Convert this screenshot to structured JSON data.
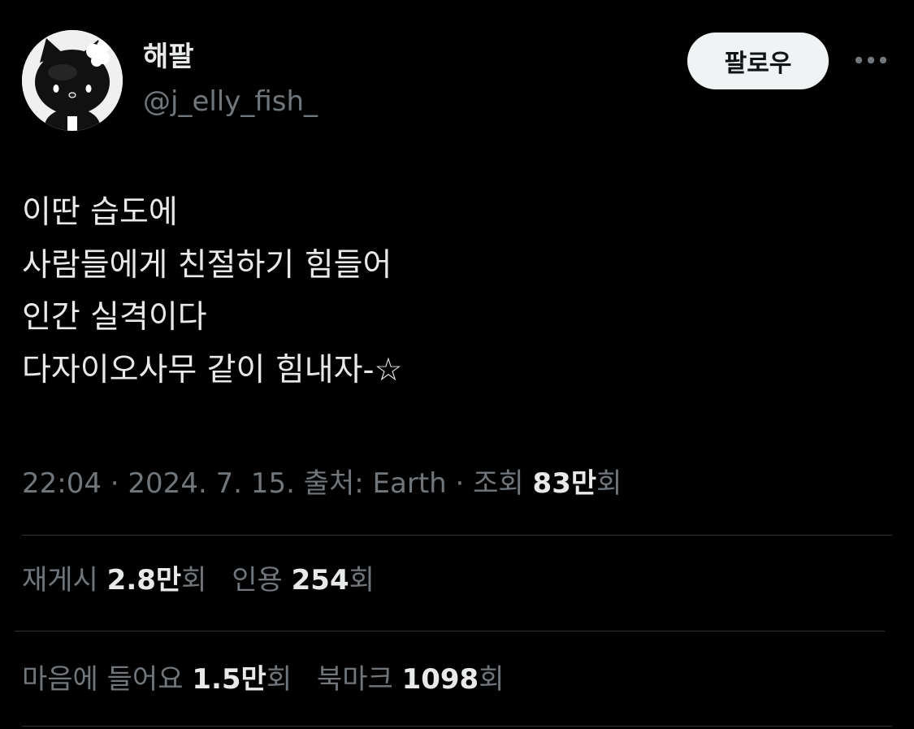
{
  "user": {
    "display_name": "해팔",
    "handle": "@j_elly_fish_",
    "avatar_icon": "hello-kitty-black-avatar"
  },
  "follow_button": {
    "label": "팔로우"
  },
  "more_menu": {
    "icon": "more-horizontal-icon"
  },
  "tweet": {
    "lines": [
      "이딴 습도에",
      "사람들에게 친절하기 힘들어",
      "인간 실격이다",
      "다자이오사무 같이 힘내자-☆"
    ]
  },
  "meta": {
    "time": "22:04",
    "date": "2024. 7. 15.",
    "source_label": "출처:",
    "source": "Earth",
    "views_label": "조회",
    "views_count": "83",
    "views_unit": "만",
    "views_suffix": "회"
  },
  "stats": {
    "reposts": {
      "label": "재게시",
      "count": "2.8",
      "unit": "만",
      "suffix": "회"
    },
    "quotes": {
      "label": "인용",
      "count": "254",
      "suffix": "회"
    },
    "likes": {
      "label": "마음에 들어요",
      "count": "1.5",
      "unit": "만",
      "suffix": "회"
    },
    "bookmarks": {
      "label": "북마크",
      "count": "1098",
      "suffix": "회"
    }
  },
  "colors": {
    "background": "#000000",
    "primary_text": "#e7e9ea",
    "secondary_text": "#71767b",
    "divider": "#2f3336",
    "follow_button_bg": "#eff3f4",
    "follow_button_text": "#0f1419"
  }
}
